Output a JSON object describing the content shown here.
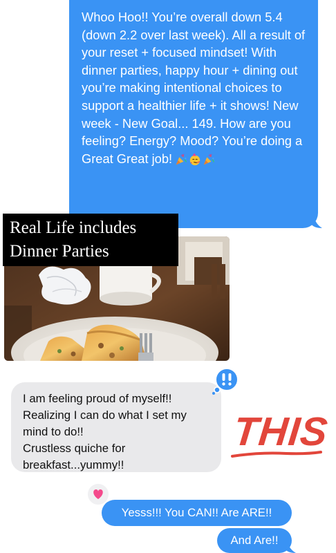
{
  "top_message": {
    "text": "Whoo Hoo!! You’re overall down 5.4 (down 2.2 over last week). All a result of your reset + focused mindset! With dinner parties, happy hour + dining out you’re making intentional choices to support a healthier life + it shows! New week - New Goal... 149. How are you feeling? Energy? Mood? You’re doing a Great Great job!",
    "emojis": [
      "party-popper-icon",
      "partying-face-icon",
      "party-popper-icon"
    ],
    "bubble_color": "#3a93f4"
  },
  "caption": {
    "line1": "Real Life includes",
    "line2": "Dinner Parties"
  },
  "reply_message": {
    "lines": [
      "I am feeling proud of myself!!",
      "Realizing I can do what I set my",
      "mind to do!!",
      "Crustless quiche for",
      "breakfast...yummy!!"
    ],
    "bubble_color": "#e9e9eb",
    "tapback": "double-exclamation-icon"
  },
  "sticker": {
    "text": "THIS",
    "color": "#e2463b"
  },
  "outgoing": [
    {
      "text": "Yesss!!! You CAN!! Are ARE!!",
      "tapback": "heart-icon"
    },
    {
      "text": "And Are!!"
    }
  ]
}
